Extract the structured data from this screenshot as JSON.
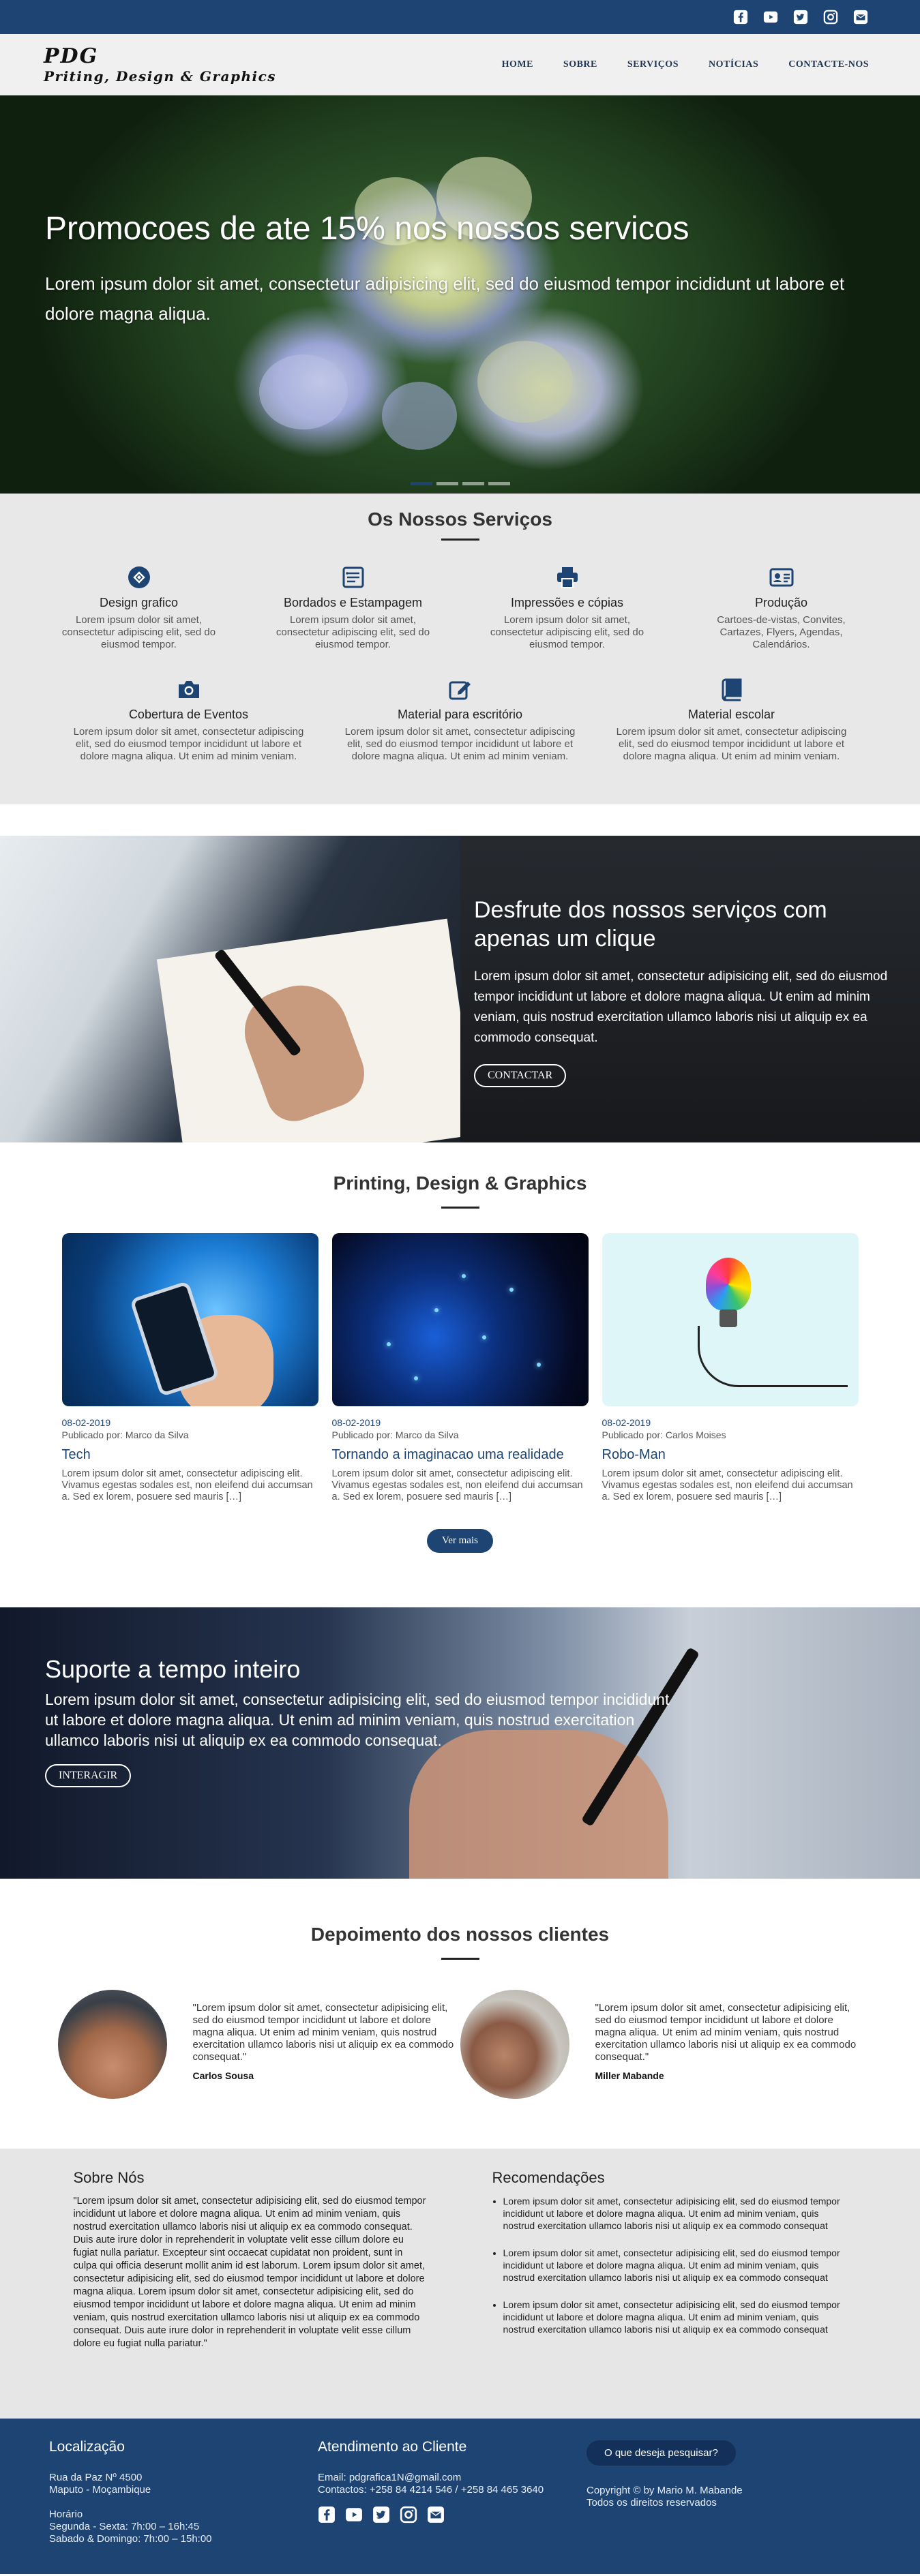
{
  "social": [
    "facebook-icon",
    "youtube-icon",
    "twitter-icon",
    "instagram-icon",
    "email-icon"
  ],
  "logo": {
    "line1": "PDG",
    "line2": "Priting, Design & Graphics"
  },
  "nav": [
    "HOME",
    "SOBRE",
    "SERVIÇOS",
    "NOTÍCIAS",
    "CONTACTE-NOS"
  ],
  "hero": {
    "title": "Promocoes de ate 15% nos nossos servicos",
    "text": "Lorem ipsum dolor sit amet, consectetur adipisicing elit, sed do eiusmod tempor incididunt ut labore et dolore magna aliqua."
  },
  "services": {
    "title": "Os Nossos Serviços",
    "items": [
      {
        "icon": "design-icon",
        "title": "Design grafico",
        "text": "Lorem ipsum dolor sit amet, consectetur adipiscing elit, sed do eiusmod tempor."
      },
      {
        "icon": "embroidery-icon",
        "title": "Bordados e Estampagem",
        "text": "Lorem ipsum dolor sit amet, consectetur adipiscing elit, sed do eiusmod tempor."
      },
      {
        "icon": "printer-icon",
        "title": "Impressões e cópias",
        "text": "Lorem ipsum dolor sit amet, consectetur adipiscing elit, sed do eiusmod tempor."
      },
      {
        "icon": "id-card-icon",
        "title": "Produção",
        "text": "Cartoes-de-vistas, Convites, Cartazes, Flyers, Agendas, Calendários."
      },
      {
        "icon": "camera-icon",
        "title": "Cobertura de Eventos",
        "text": "Lorem ipsum dolor sit amet, consectetur adipiscing elit, sed do eiusmod tempor incididunt ut labore et dolore magna aliqua. Ut enim ad minim veniam."
      },
      {
        "icon": "edit-icon",
        "title": "Material para escritório",
        "text": "Lorem ipsum dolor sit amet, consectetur adipiscing elit, sed do eiusmod tempor incididunt ut labore et dolore magna aliqua. Ut enim ad minim veniam."
      },
      {
        "icon": "book-icon",
        "title": "Material escolar",
        "text": "Lorem ipsum dolor sit amet, consectetur adipiscing elit, sed do eiusmod tempor incididunt ut labore et dolore magna aliqua. Ut enim ad minim veniam."
      }
    ]
  },
  "band1": {
    "title": "Desfrute dos nossos serviços com apenas um clique",
    "text": "Lorem ipsum dolor sit amet, consectetur adipisicing elit, sed do eiusmod tempor incididunt ut labore et dolore magna aliqua. Ut enim ad minim veniam, quis nostrud exercitation ullamco laboris nisi ut aliquip ex ea commodo consequat.",
    "button": "CONTACTAR"
  },
  "blog": {
    "title": "Printing, Design & Graphics",
    "posts": [
      {
        "date": "08-02-2019",
        "by": "Publicado por: Marco da Silva",
        "title": "Tech",
        "text": "Lorem ipsum dolor sit amet, consectetur adipiscing elit. Vivamus egestas sodales est, non eleifend dui accumsan a. Sed ex lorem, posuere sed mauris […]"
      },
      {
        "date": "08-02-2019",
        "by": "Publicado por: Marco da Silva",
        "title": "Tornando a imaginacao uma realidade",
        "text": "Lorem ipsum dolor sit amet, consectetur adipiscing elit. Vivamus egestas sodales est, non eleifend dui accumsan a. Sed ex lorem, posuere sed mauris […]"
      },
      {
        "date": "08-02-2019",
        "by": "Publicado por: Carlos Moises",
        "title": "Robo-Man",
        "text": "Lorem ipsum dolor sit amet, consectetur adipiscing elit. Vivamus egestas sodales est, non eleifend dui accumsan a. Sed ex lorem, posuere sed mauris […]"
      }
    ],
    "more": "Ver mais"
  },
  "band2": {
    "title": "Suporte a tempo inteiro",
    "text": "Lorem ipsum dolor sit amet, consectetur adipisicing elit, sed do eiusmod tempor incididunt ut labore et dolore magna aliqua. Ut enim ad minim veniam, quis nostrud exercitation ullamco laboris nisi ut aliquip ex ea commodo consequat.",
    "button": "INTERAGIR"
  },
  "testimonials": {
    "title": "Depoimento dos nossos clientes",
    "items": [
      {
        "quote": "\"Lorem ipsum dolor sit amet, consectetur adipisicing elit, sed do eiusmod tempor incididunt ut labore et dolore magna aliqua. Ut enim ad minim veniam, quis nostrud exercitation ullamco laboris nisi ut aliquip ex ea commodo consequat.\"",
        "author": "Carlos Sousa"
      },
      {
        "quote": "\"Lorem ipsum dolor sit amet, consectetur adipisicing elit, sed do eiusmod tempor incididunt ut labore et dolore magna aliqua. Ut enim ad minim veniam, quis nostrud exercitation ullamco laboris nisi ut aliquip ex ea commodo consequat.\"",
        "author": "Miller Mabande"
      }
    ]
  },
  "about": {
    "title": "Sobre Nós",
    "text": "\"Lorem ipsum dolor sit amet, consectetur adipisicing elit, sed do eiusmod tempor incididunt ut labore et dolore magna aliqua. Ut enim ad minim veniam, quis nostrud exercitation ullamco laboris nisi ut aliquip ex ea commodo consequat. Duis aute irure dolor in reprehenderit in voluptate velit esse cillum dolore eu fugiat nulla pariatur. Excepteur sint occaecat cupidatat non proident, sunt in culpa qui officia deserunt mollit anim id est laborum. Lorem ipsum dolor sit amet, consectetur adipisicing elit, sed do eiusmod tempor incididunt ut labore et dolore magna aliqua. Lorem ipsum dolor sit amet, consectetur adipisicing elit, sed do eiusmod tempor incididunt ut labore et dolore magna aliqua. Ut enim ad minim veniam, quis nostrud exercitation ullamco laboris nisi ut aliquip ex ea commodo consequat. Duis aute irure dolor in reprehenderit in voluptate velit esse cillum dolore eu fugiat nulla pariatur.\"",
    "rec_title": "Recomendações",
    "recs": [
      "Lorem ipsum dolor sit amet, consectetur adipisicing elit, sed do eiusmod tempor incididunt ut labore et dolore magna aliqua. Ut enim ad minim veniam, quis nostrud exercitation ullamco laboris nisi ut aliquip ex ea commodo consequat",
      "Lorem ipsum dolor sit amet, consectetur adipisicing elit, sed do eiusmod tempor incididunt ut labore et dolore magna aliqua. Ut enim ad minim veniam, quis nostrud exercitation ullamco laboris nisi ut aliquip ex ea commodo consequat",
      "Lorem ipsum dolor sit amet, consectetur adipisicing elit, sed do eiusmod tempor incididunt ut labore et dolore magna aliqua. Ut enim ad minim veniam, quis nostrud exercitation ullamco laboris nisi ut aliquip ex ea commodo consequat"
    ]
  },
  "footer": {
    "loc_title": "Localização",
    "address1": "Rua da Paz Nº 4500",
    "address2": "Maputo - Moçambique",
    "hours_title": "Horário",
    "hours1": "Segunda - Sexta: 7h:00 – 16h:45",
    "hours2": "Sabado & Domingo: 7h:00 – 15h:00",
    "svc_title": "Atendimento ao Cliente",
    "email": "Email: pdgrafica1N@gmail.com",
    "phones": "Contactos: +258 84 4214 546 / +258 84 465 3640",
    "search": "O que deseja pesquisar?",
    "copyright": "Copyright © by Mario M. Mabande",
    "rights": "Todos os direitos reservados"
  }
}
